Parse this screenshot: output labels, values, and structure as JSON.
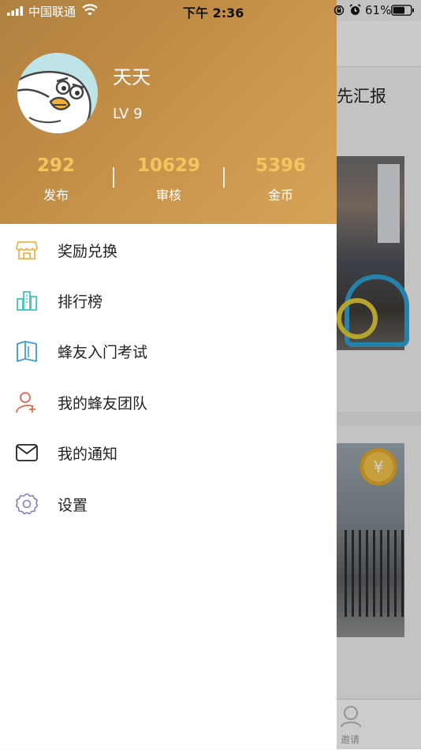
{
  "status_bar": {
    "carrier": "中国联通",
    "time": "下午 2:36",
    "battery": "61%"
  },
  "background": {
    "title_fragment": "先汇报",
    "tab_invite": "邀请",
    "coin_symbol": "¥"
  },
  "profile": {
    "name": "天天",
    "level": "LV 9"
  },
  "stats": [
    {
      "value": "292",
      "label": "发布"
    },
    {
      "value": "10629",
      "label": "审核"
    },
    {
      "value": "5396",
      "label": "金币"
    }
  ],
  "menu": [
    {
      "label": "奖励兑换",
      "icon": "shop-icon"
    },
    {
      "label": "排行榜",
      "icon": "ranking-buildings-icon"
    },
    {
      "label": "蜂友入门考试",
      "icon": "book-icon"
    },
    {
      "label": "我的蜂友团队",
      "icon": "add-user-icon"
    },
    {
      "label": "我的通知",
      "icon": "mail-icon"
    },
    {
      "label": "设置",
      "icon": "gear-icon"
    }
  ],
  "colors": {
    "header_gradient_start": "#b0803f",
    "header_gradient_end": "#d7a457",
    "stat_number": "#f6c45e",
    "icon_orange": "#f2b24a",
    "icon_teal": "#3cc6c0",
    "icon_blue": "#3d9bd6",
    "icon_red": "#e8664a",
    "icon_purple": "#8a7bc4"
  }
}
